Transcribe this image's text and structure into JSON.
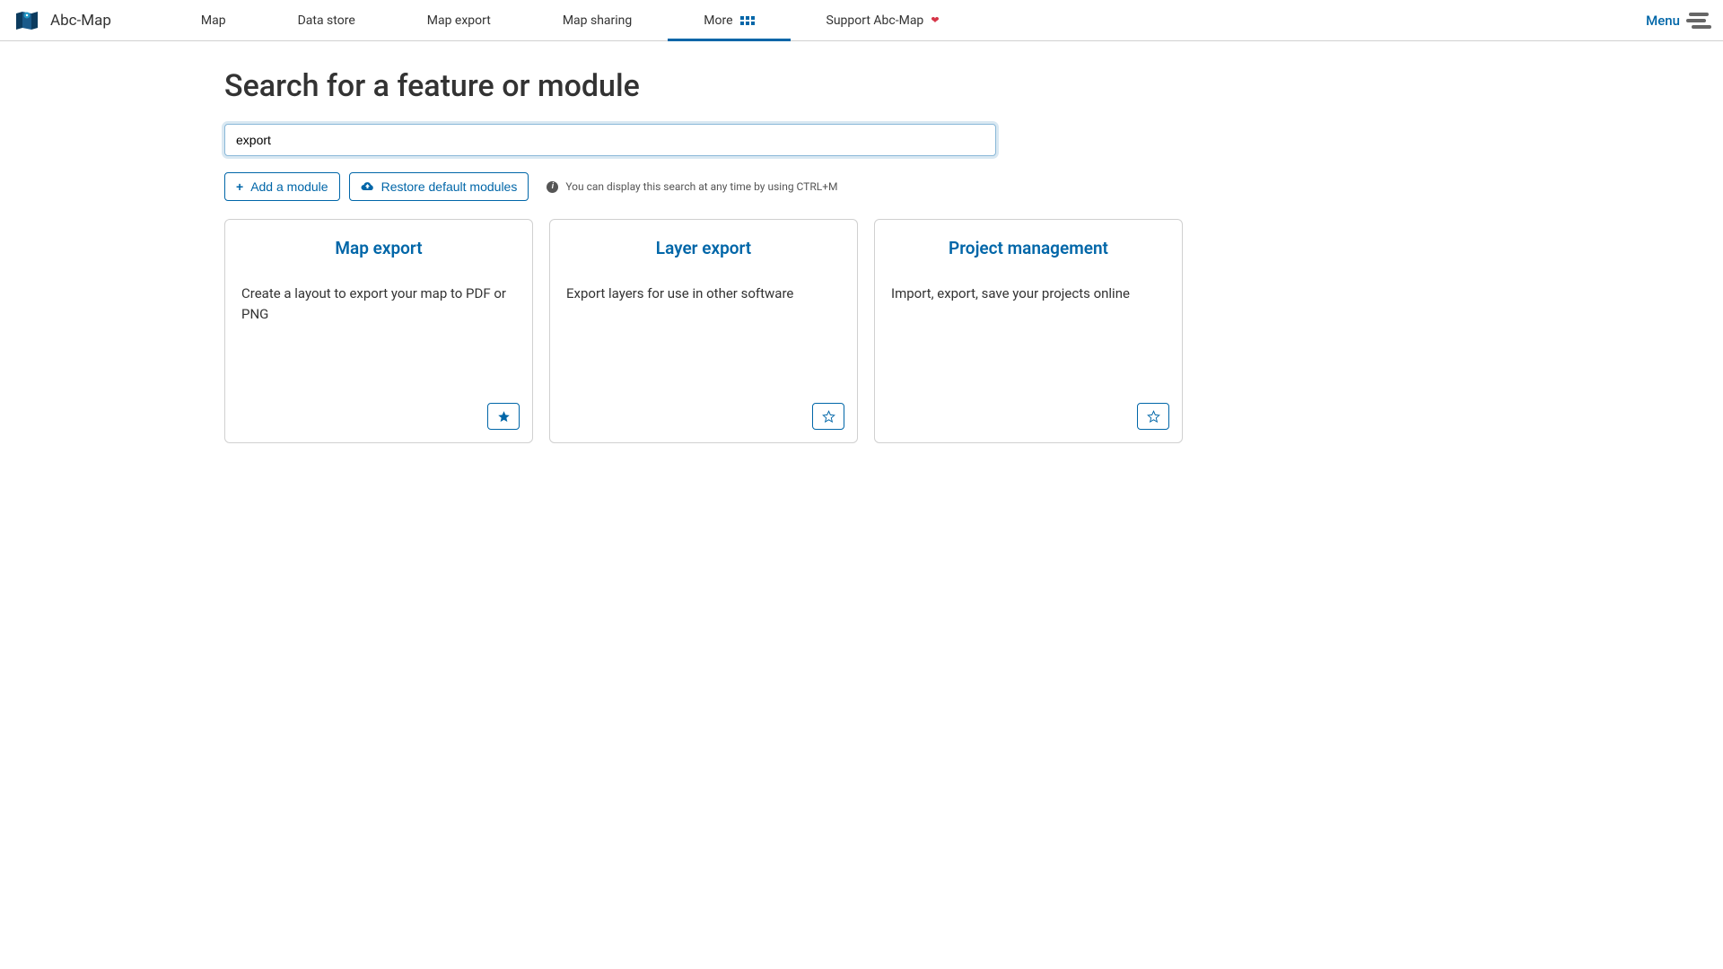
{
  "header": {
    "app_name": "Abc-Map",
    "nav": {
      "map": "Map",
      "data_store": "Data store",
      "map_export": "Map export",
      "map_sharing": "Map sharing",
      "more": "More",
      "support": "Support Abc-Map"
    },
    "menu_label": "Menu"
  },
  "page": {
    "title": "Search for a feature or module",
    "search_value": "export",
    "add_module_label": "Add a module",
    "restore_label": "Restore default modules",
    "hint": "You can display this search at any time by using CTRL+M"
  },
  "results": [
    {
      "title": "Map export",
      "description": "Create a layout to export your map to PDF or PNG",
      "favorited": true
    },
    {
      "title": "Layer export",
      "description": "Export layers for use in other software",
      "favorited": false
    },
    {
      "title": "Project management",
      "description": "Import, export, save your projects online",
      "favorited": false
    }
  ]
}
